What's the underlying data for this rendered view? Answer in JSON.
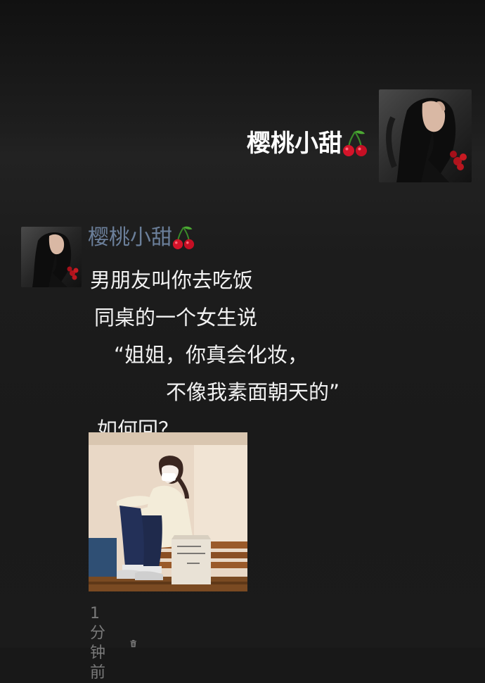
{
  "header": {
    "user_name": "樱桃小甜"
  },
  "post": {
    "author_name": "樱桃小甜",
    "lines": [
      "男朋友叫你去吃饭",
      "同桌的一个女生说",
      "“姐姐，你真会化妆，",
      "不像我素面朝天的”",
      "如何回？"
    ],
    "timestamp": "1分钟前"
  },
  "icons": {
    "emoji": "cherry-emoji-icon",
    "delete": "trash-icon"
  },
  "colors": {
    "background": "#181818",
    "author_name": "#6b7f9a",
    "body_text": "#f2f2f2",
    "timestamp": "#7a7a7a"
  }
}
